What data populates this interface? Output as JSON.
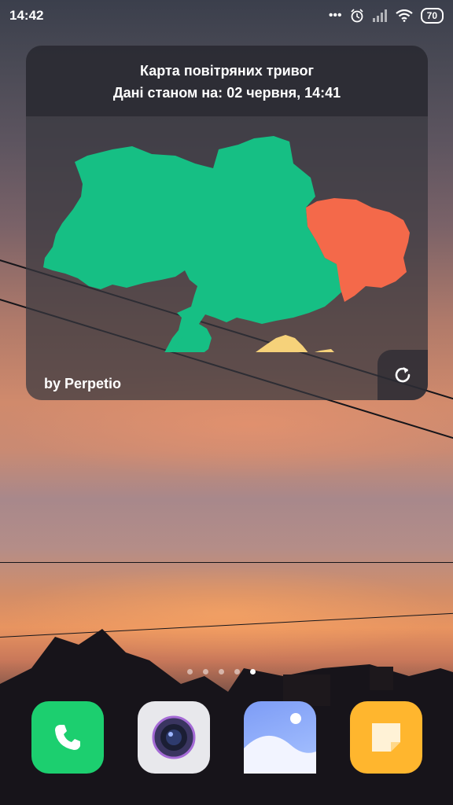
{
  "status_bar": {
    "time": "14:42",
    "battery": "70",
    "icons": [
      "more-dots-icon",
      "alarm-icon",
      "signal-icon",
      "wifi-icon",
      "battery-icon"
    ]
  },
  "widget": {
    "title": "Карта повітряних тривог",
    "updated_label": "Дані станом на:",
    "updated_value": "02 червня, 14:41",
    "credit": "by Perpetio",
    "refresh_icon": "refresh-icon",
    "colors": {
      "no_alert": "#16bf84",
      "alert": "#f4694a",
      "occupied": "#f6d27a"
    },
    "regions_state": [
      "no_alert",
      "alert",
      "occupied"
    ]
  },
  "home": {
    "pages": 5,
    "active_page": 5
  },
  "dock": {
    "apps": [
      {
        "name": "phone-app",
        "icon": "phone-icon",
        "color": "#1ccf6f"
      },
      {
        "name": "camera-app",
        "icon": "camera-icon",
        "color": "#e8e8ec"
      },
      {
        "name": "gallery-app",
        "icon": "gallery-icon",
        "color": "#6f8cf2"
      },
      {
        "name": "notes-app",
        "icon": "notes-icon",
        "color": "#ffb62e"
      }
    ]
  }
}
